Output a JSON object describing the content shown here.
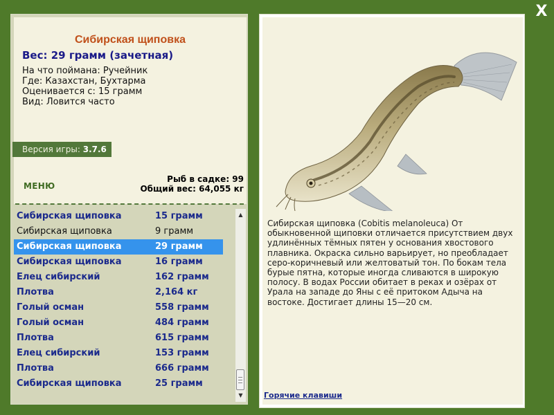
{
  "close_label": "X",
  "fish": {
    "title": "Сибирская щиповка",
    "weight_line": "Вес: 29 грамм (зачетная)",
    "details": [
      "На что поймана: Ручейник",
      "Где: Казахстан, Бухтарма",
      "Оценивается с: 15 грамм",
      "Вид: Ловится часто"
    ],
    "description": "Сибирская щиповка (Cobitis melanoleuca) От обыкновенной щиповки отличается присутствием двух удлинённых тёмных пятен у основания хвостового плавника. Окраска сильно варьирует, но преобладает серо-коричневый или желтоватый тон. По бокам тела бурые пятна, которые иногда сливаются в широкую полосу. В водах России обитает в реках и озёрах от Урала на западе до Яны с её притоком Адыча на востоке. Достигает длины 15—20 см."
  },
  "version": {
    "label": "Версия игры:",
    "value": "3.7.6"
  },
  "menu_label": "МЕНЮ",
  "stats": {
    "fish_count": "Рыб в садке: 99",
    "total_weight": "Общий вес: 64,055 кг"
  },
  "catch_list": [
    {
      "name": "Сибирская щиповка",
      "weight": "15 грамм",
      "style": "bold"
    },
    {
      "name": "Сибирская щиповка",
      "weight": "9 грамм",
      "style": "plain"
    },
    {
      "name": "Сибирская щиповка",
      "weight": "29 грамм",
      "style": "selected"
    },
    {
      "name": "Сибирская щиповка",
      "weight": "16 грамм",
      "style": "bold"
    },
    {
      "name": "Елец сибирский",
      "weight": "162 грамм",
      "style": "bold"
    },
    {
      "name": "Плотва",
      "weight": "2,164 кг",
      "style": "bold"
    },
    {
      "name": "Голый осман",
      "weight": "558 грамм",
      "style": "bold"
    },
    {
      "name": "Голый осман",
      "weight": "484 грамм",
      "style": "bold"
    },
    {
      "name": "Плотва",
      "weight": "615 грамм",
      "style": "bold"
    },
    {
      "name": "Елец сибирский",
      "weight": "153 грамм",
      "style": "bold"
    },
    {
      "name": "Плотва",
      "weight": "666 грамм",
      "style": "bold"
    },
    {
      "name": "Сибирская щиповка",
      "weight": "25 грамм",
      "style": "bold"
    }
  ],
  "hotkeys_label": "Горячие клавиши",
  "colors": {
    "frame_green": "#4f7a2a",
    "panel_bg": "#f4f2e0",
    "list_bg": "#d4d6ba",
    "title_orange": "#c0501a",
    "link_blue": "#1b2a8c",
    "selection_blue": "#3593ec"
  }
}
